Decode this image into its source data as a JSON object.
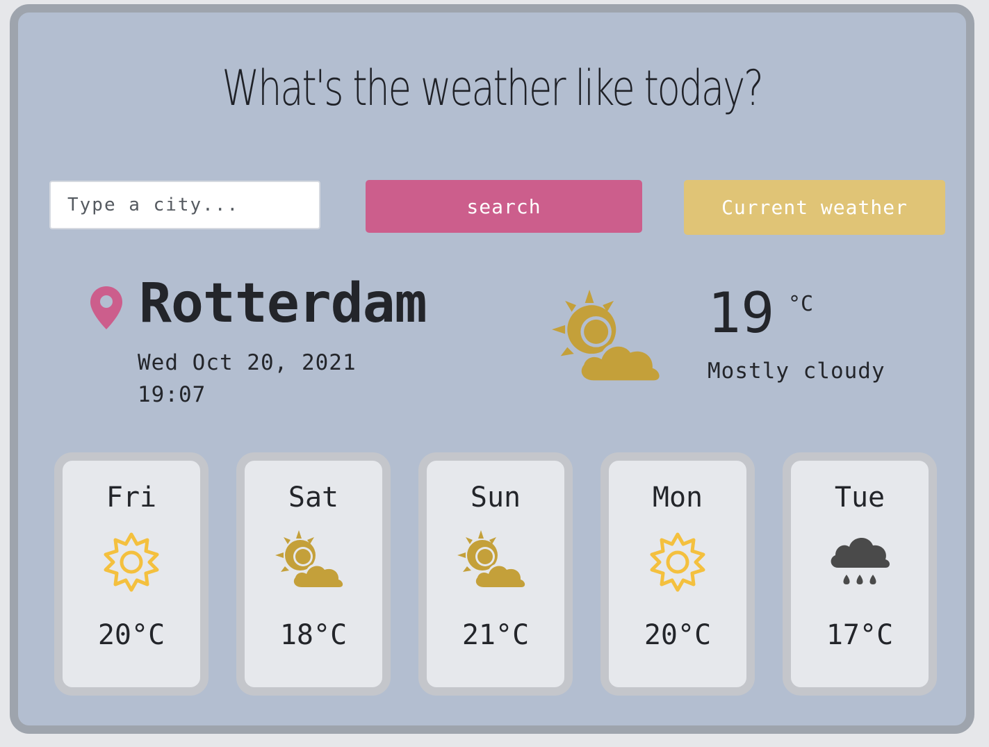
{
  "header": {
    "title": "What's the weather like today?"
  },
  "search": {
    "placeholder": "Type a city...",
    "search_label": "search",
    "current_label": "Current weather"
  },
  "current": {
    "city": "Rotterdam",
    "date": "Wed Oct 20, 2021",
    "time": "19:07",
    "temperature": "19",
    "unit": "°C",
    "description": "Mostly cloudy",
    "icon": "sun-behind-cloud-icon"
  },
  "forecast": [
    {
      "day": "Fri",
      "temp": "20°C",
      "icon": "sun-icon"
    },
    {
      "day": "Sat",
      "temp": "18°C",
      "icon": "sun-behind-cloud-icon"
    },
    {
      "day": "Sun",
      "temp": "21°C",
      "icon": "sun-behind-cloud-icon"
    },
    {
      "day": "Mon",
      "temp": "20°C",
      "icon": "sun-icon"
    },
    {
      "day": "Tue",
      "temp": "17°C",
      "icon": "rain-cloud-icon"
    }
  ],
  "colors": {
    "background": "#b3bed0",
    "frame": "#9ea4ad",
    "search_button": "#cc5e8c",
    "current_button": "#e0c476",
    "pin": "#cc5e8c",
    "sun_outline": "#f4c03e",
    "sun_cloud": "#c4a03a",
    "rain_cloud": "#4a4a4a",
    "card_bg": "#e6e8ec",
    "card_border": "#c4c6cb"
  }
}
